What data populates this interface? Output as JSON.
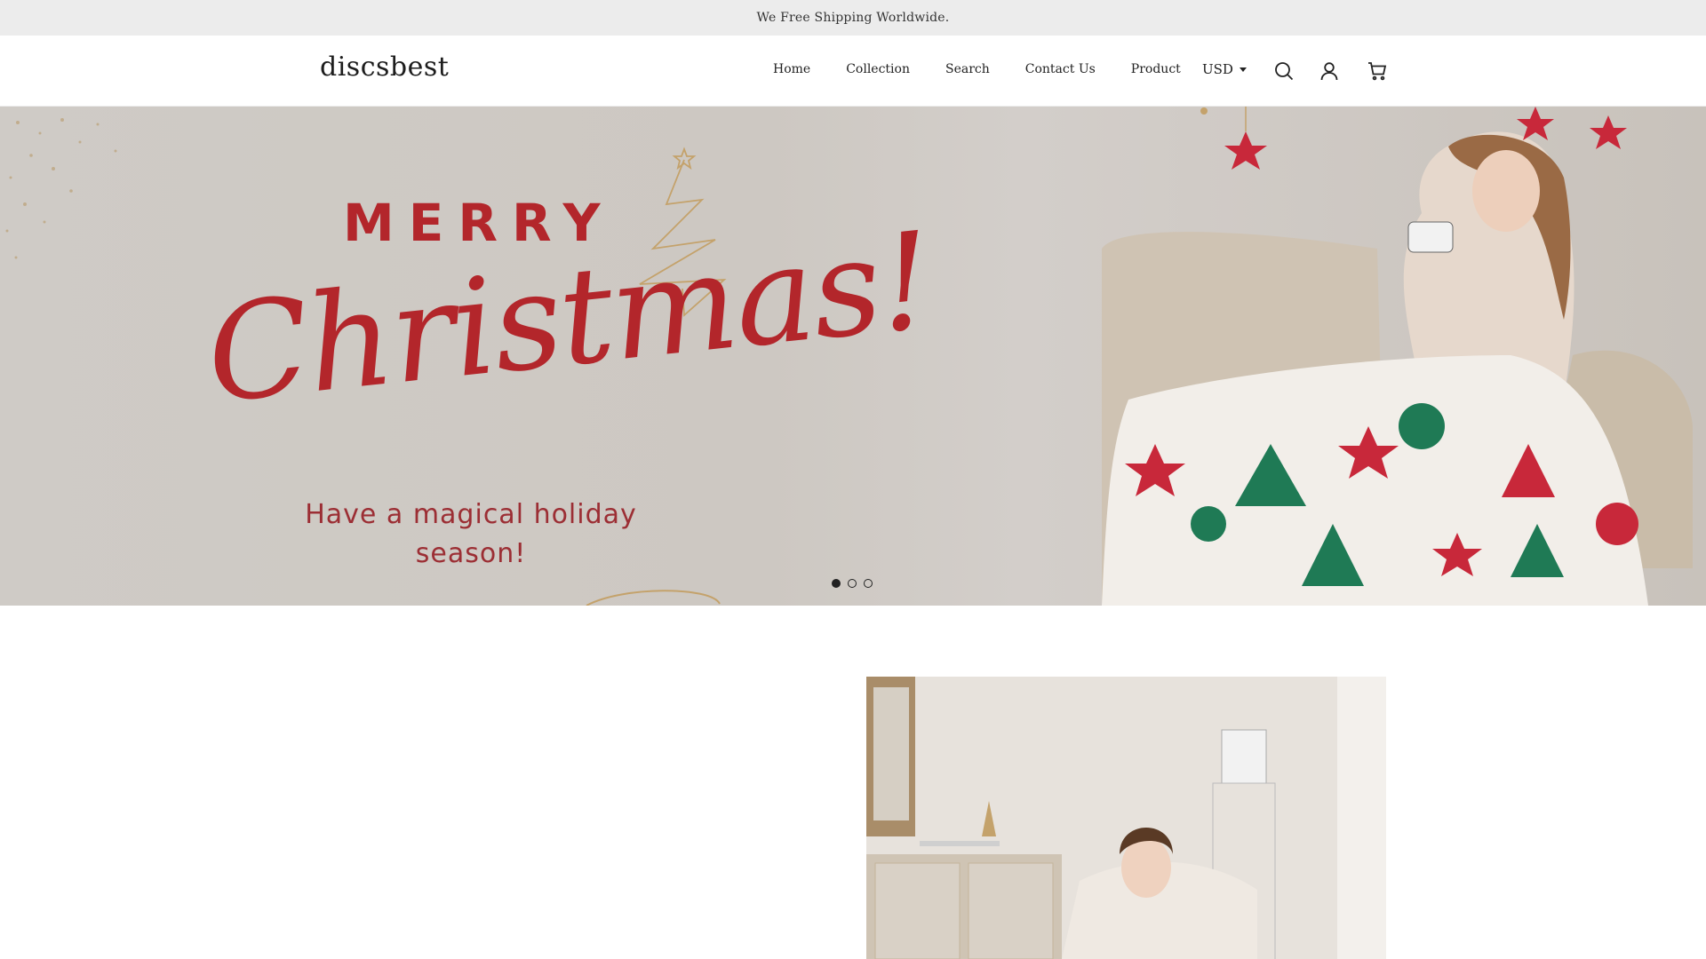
{
  "announcement": {
    "text": "We Free Shipping Worldwide."
  },
  "header": {
    "logo": "discsbest",
    "nav": [
      "Home",
      "Collection",
      "Search",
      "Contact Us",
      "Product"
    ],
    "currency": "USD",
    "icons": [
      "search-icon",
      "account-icon",
      "cart-icon"
    ]
  },
  "hero": {
    "merry": "MERRY",
    "christmas": "Christmas!",
    "subtitle_line1": "Have a magical holiday",
    "subtitle_line2": "season!",
    "slides": 3,
    "active_slide": 1
  },
  "colors": {
    "announcement_bg": "#ececec",
    "hero_bg": "#cfcbc6",
    "hero_red": "#b3262b",
    "text": "#222222"
  }
}
